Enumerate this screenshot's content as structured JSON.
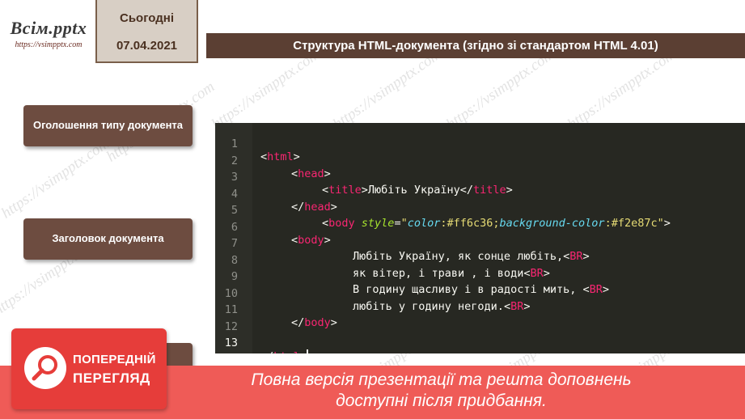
{
  "logo": {
    "title": "Всім.pptx",
    "url": "https://vsimpptx.com"
  },
  "date_box": {
    "label": "Сьогодні",
    "date": "07.04.2021"
  },
  "slide_title": "Структура HTML-документа (згідно зі стандартом HTML 4.01)",
  "sidebar": {
    "items": [
      {
        "label": "Оголошення типу документа"
      },
      {
        "label": "Заголовок документа"
      },
      {
        "label": ""
      }
    ]
  },
  "code": {
    "line_numbers": [
      "1",
      "2",
      "3",
      "4",
      "5",
      "6",
      "7",
      "8",
      "9",
      "10",
      "11",
      "12",
      "13"
    ],
    "line1": {
      "open": "<",
      "tag": "html",
      "close": ">"
    },
    "line2": {
      "open": "<",
      "tag": "head",
      "close": ">"
    },
    "line3": {
      "open1": "<",
      "tag1": "title",
      "close1": ">",
      "text": "Любіть Україну",
      "open2": "</",
      "tag2": "title",
      "close2": ">"
    },
    "line4": {
      "open": "</",
      "tag": "head",
      "close": ">"
    },
    "line5": {
      "open": "<",
      "tag": "body",
      "attr": "style",
      "eq": "=",
      "q1": "\"",
      "prop1": "color",
      "val1": ":#ff6c36;",
      "prop2": "background-color",
      "val2": ":#f2e87c",
      "q2": "\"",
      "close": ">"
    },
    "line6": {
      "open": "<",
      "tag": "body",
      "close": ">"
    },
    "line7": {
      "text": "Любіть Україну, як сонце любіть,",
      "open": "<",
      "tag": "BR",
      "close": ">"
    },
    "line8": {
      "text": "як вітер, і трави , і води",
      "open": "<",
      "tag": "BR",
      "close": ">"
    },
    "line9": {
      "text": "В годину щасливу і в радості мить, ",
      "open": "<",
      "tag": "BR",
      "close": ">"
    },
    "line10": {
      "text": "любіть у годину негоди.",
      "open": "<",
      "tag": "BR",
      "close": ">"
    },
    "line11": {
      "open": "</",
      "tag": "body",
      "close": ">"
    },
    "line13": {
      "open": "</",
      "tag": "html",
      "close": ">"
    }
  },
  "preview": {
    "line1": "ПОПЕРЕДНІЙ",
    "line2": "ПЕРЕГЛЯД"
  },
  "banner": {
    "line1": "Повна версія презентації та решта доповнень",
    "line2": "доступні після придбання."
  },
  "watermark": "https://vsimpptx.com",
  "colors": {
    "title_bar": "#5b3f33",
    "sidebar_button": "#6d4c40",
    "date_box": "#d8cfc5",
    "code_bg": "#272822",
    "banner": "#ef5b57",
    "preview_badge": "#e63d3a"
  }
}
